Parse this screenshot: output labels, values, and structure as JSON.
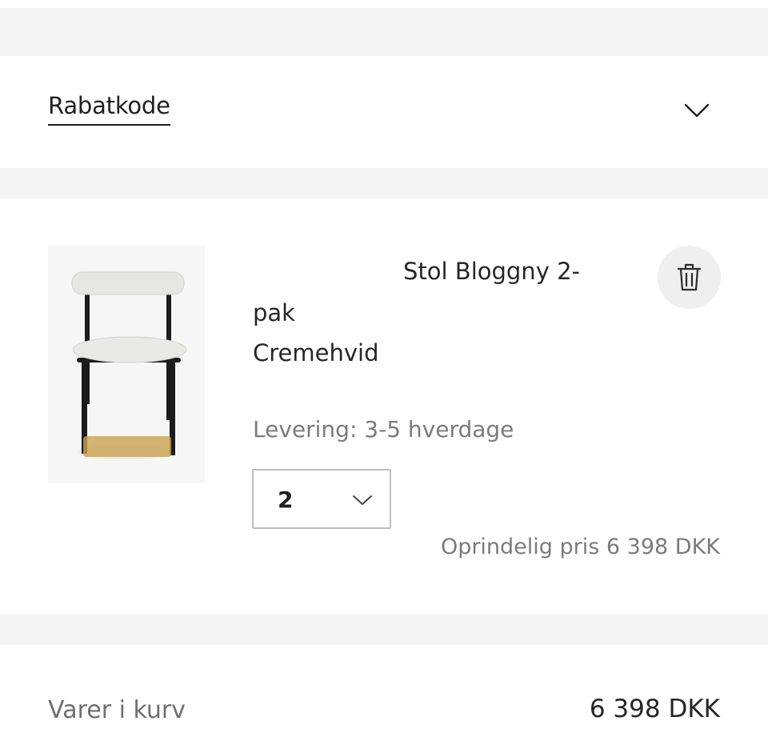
{
  "discount": {
    "label": "Rabatkode",
    "toggle_icon": "chevron-down-icon"
  },
  "cart_item": {
    "image_icon": "chair-image",
    "name_line1": "Stol Bloggny 2-",
    "name_line2": "pak",
    "variant": "Cremehvid",
    "delivery": "Levering: 3-5 hverdage",
    "delete_icon": "trash-icon",
    "quantity": "2",
    "quantity_icon": "chevron-down-icon",
    "original_price": "Oprindelig pris 6 398 DKK"
  },
  "summary": {
    "label": "Varer i kurv",
    "value": "6 398 DKK"
  },
  "colors": {
    "band": "#f4f4f4",
    "text": "#262626",
    "muted": "#7b7b7b"
  }
}
